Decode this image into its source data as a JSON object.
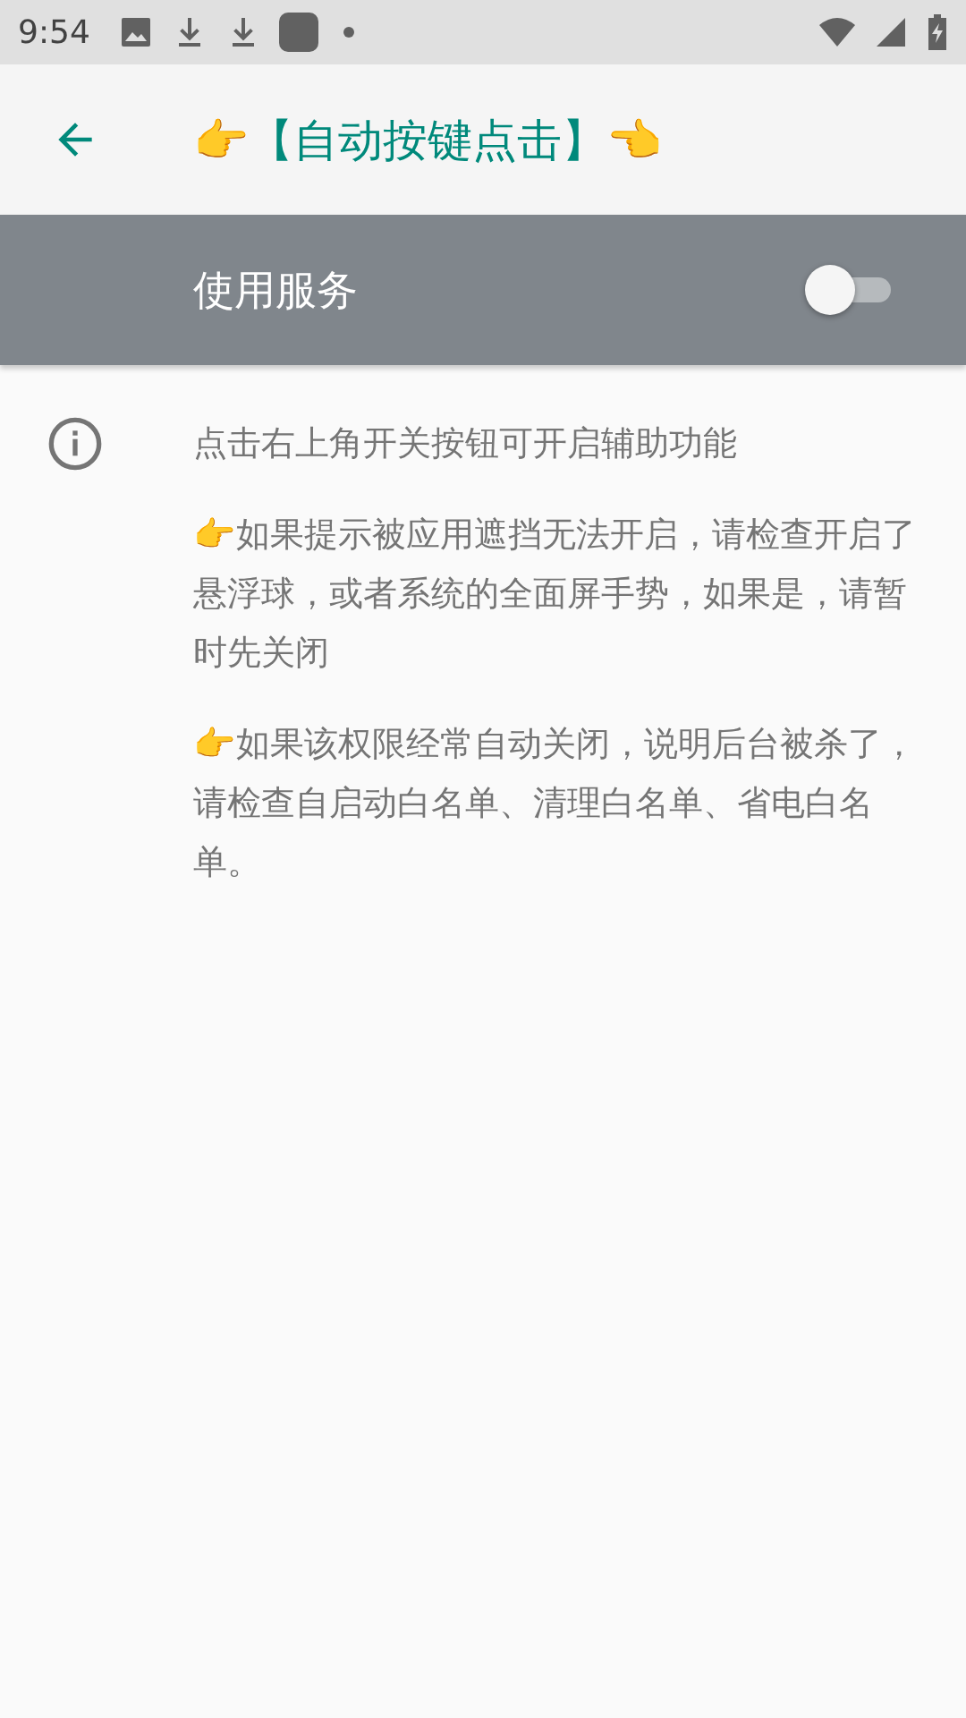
{
  "status_bar": {
    "time": "9:54"
  },
  "toolbar": {
    "title": "👉【自动按键点击】👈"
  },
  "service_switch": {
    "label": "使用服务",
    "on": false
  },
  "info": {
    "paragraphs": [
      "点击右上角开关按钮可开启辅助功能",
      "👉如果提示被应用遮挡无法开启，请检查开启了悬浮球，或者系统的全面屏手势，如果是，请暂时先关闭",
      "👉如果该权限经常自动关闭，说明后台被杀了，请检查自启动白名单、清理白名单、省电白名单。"
    ]
  }
}
